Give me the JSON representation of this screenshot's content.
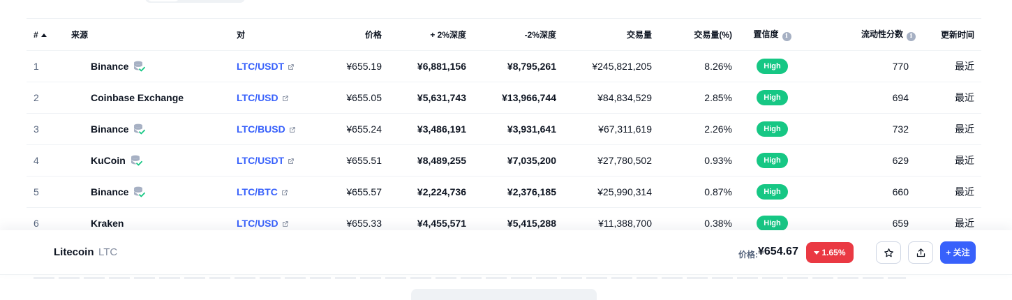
{
  "table": {
    "headers": {
      "rank": "#",
      "source": "来源",
      "pair": "对",
      "price": "价格",
      "depth_plus": "+ 2%深度",
      "depth_minus": "-2%深度",
      "volume": "交易量",
      "volume_pct": "交易量(%)",
      "confidence": "置信度",
      "liquidity": "流动性分数",
      "updated": "更新时间"
    },
    "rows": [
      {
        "rank": "1",
        "source": "Binance",
        "verified": true,
        "pair": "LTC/USDT",
        "price": "¥655.19",
        "depth_plus": "¥6,881,156",
        "depth_minus": "¥8,795,261",
        "volume": "¥245,821,205",
        "volume_pct": "8.26%",
        "confidence": "High",
        "liquidity": "770",
        "updated": "最近"
      },
      {
        "rank": "2",
        "source": "Coinbase Exchange",
        "verified": false,
        "pair": "LTC/USD",
        "price": "¥655.05",
        "depth_plus": "¥5,631,743",
        "depth_minus": "¥13,966,744",
        "volume": "¥84,834,529",
        "volume_pct": "2.85%",
        "confidence": "High",
        "liquidity": "694",
        "updated": "最近"
      },
      {
        "rank": "3",
        "source": "Binance",
        "verified": true,
        "pair": "LTC/BUSD",
        "price": "¥655.24",
        "depth_plus": "¥3,486,191",
        "depth_minus": "¥3,931,641",
        "volume": "¥67,311,619",
        "volume_pct": "2.26%",
        "confidence": "High",
        "liquidity": "732",
        "updated": "最近"
      },
      {
        "rank": "4",
        "source": "KuCoin",
        "verified": true,
        "pair": "LTC/USDT",
        "price": "¥655.51",
        "depth_plus": "¥8,489,255",
        "depth_minus": "¥7,035,200",
        "volume": "¥27,780,502",
        "volume_pct": "0.93%",
        "confidence": "High",
        "liquidity": "629",
        "updated": "最近"
      },
      {
        "rank": "5",
        "source": "Binance",
        "verified": true,
        "pair": "LTC/BTC",
        "price": "¥655.57",
        "depth_plus": "¥2,224,736",
        "depth_minus": "¥2,376,185",
        "volume": "¥25,990,314",
        "volume_pct": "0.87%",
        "confidence": "High",
        "liquidity": "660",
        "updated": "最近"
      },
      {
        "rank": "6",
        "source": "Kraken",
        "verified": false,
        "pair": "LTC/USD",
        "price": "¥655.33",
        "depth_plus": "¥4,455,571",
        "depth_minus": "¥5,415,288",
        "volume": "¥11,388,700",
        "volume_pct": "0.38%",
        "confidence": "High",
        "liquidity": "659",
        "updated": "最近"
      }
    ]
  },
  "bottom_bar": {
    "coin_name": "Litecoin",
    "coin_symbol": "LTC",
    "price_label": "价格:",
    "price": "¥654.67",
    "change": "1.65%",
    "follow_label": "+ 关注"
  },
  "colors": {
    "accent": "#3861fb",
    "high_badge": "#16c784",
    "negative": "#ea3943",
    "muted": "#58667e"
  },
  "icons": [
    "sort-up-icon",
    "info-icon",
    "external-link-icon",
    "verified-exchange-icon",
    "caret-down-icon",
    "star-icon",
    "share-icon"
  ]
}
